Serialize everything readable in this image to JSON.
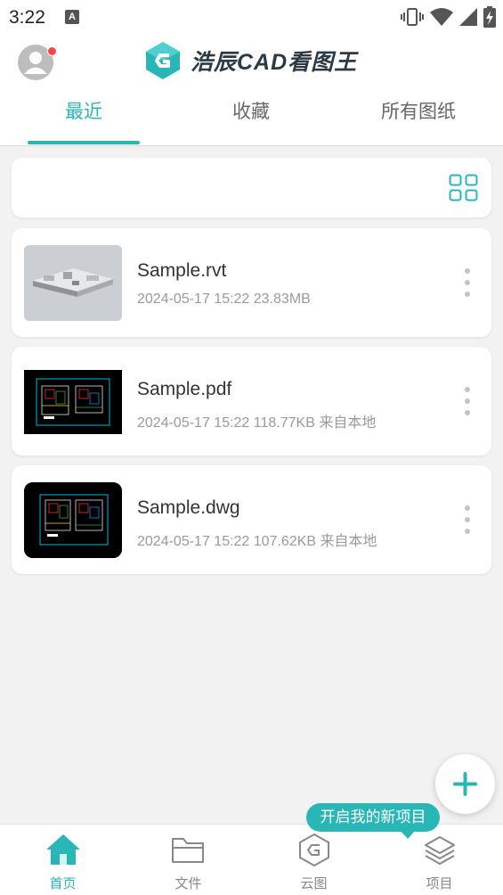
{
  "status_bar": {
    "time": "3:22",
    "notif_letter": "A",
    "icons": [
      "vibrate-icon",
      "wifi-icon",
      "signal-icon",
      "battery-charging-icon"
    ]
  },
  "header": {
    "app_name": "浩辰CAD看图王",
    "has_notification_dot": true
  },
  "tabs": [
    {
      "label": "最近",
      "active": true
    },
    {
      "label": "收藏",
      "active": false
    },
    {
      "label": "所有图纸",
      "active": false
    }
  ],
  "toolbar": {
    "view_toggle_icon": "grid-view-icon"
  },
  "files": [
    {
      "name": "Sample.rvt",
      "meta": "2024-05-17 15:22  23.83MB",
      "thumb": "3d-model"
    },
    {
      "name": "Sample.pdf",
      "meta": "2024-05-17 15:22  118.77KB  来自本地",
      "thumb": "cad-drawing"
    },
    {
      "name": "Sample.dwg",
      "meta": "2024-05-17 15:22  107.62KB  来自本地",
      "thumb": "cad-drawing"
    }
  ],
  "fab": {
    "icon": "plus-icon"
  },
  "tooltip": {
    "text": "开启我的新项目"
  },
  "bottom_nav": [
    {
      "label": "首页",
      "icon": "home-icon",
      "active": true
    },
    {
      "label": "文件",
      "icon": "folder-icon",
      "active": false
    },
    {
      "label": "云图",
      "icon": "cloud-drawing-icon",
      "active": false
    },
    {
      "label": "项目",
      "icon": "layers-icon",
      "active": false
    }
  ],
  "colors": {
    "accent": "#29b6b7",
    "background": "#f2f2f2",
    "card": "#ffffff",
    "text_primary": "#333333",
    "text_secondary": "#9a9a9a",
    "notification_dot": "#ff4444"
  }
}
